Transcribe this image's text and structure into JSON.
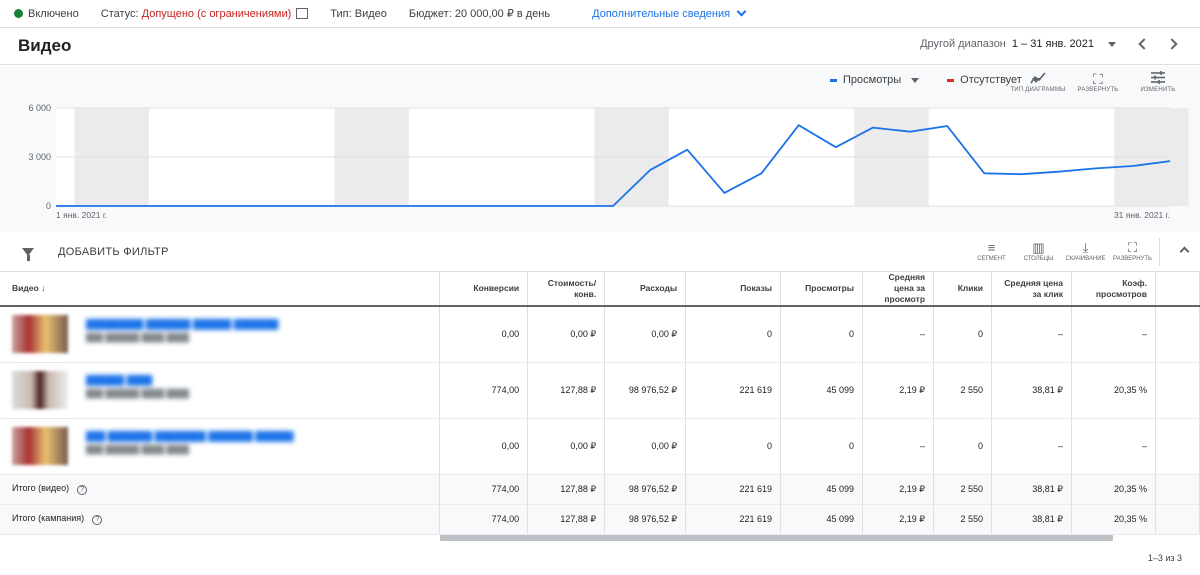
{
  "topbar": {
    "status_on": "Включено",
    "status_label": "Статус:",
    "status_value": "Допущено (с ограничениями)",
    "type_label": "Тип:",
    "type_value": "Видео",
    "budget_label": "Бюджет:",
    "budget_value": "20 000,00 ₽ в день",
    "extra": "Дополнительные сведения",
    "status_on_color": "#188038",
    "status_value_color": "#c5221f"
  },
  "header": {
    "title": "Видео",
    "range_label": "Другой диапазон",
    "range_value": "1 – 31 янв. 2021"
  },
  "chart_toolbar": {
    "legend1": "Просмотры",
    "legend1_color": "#1a73e8",
    "legend2": "Отсутствует",
    "legend2_color": "#d93025",
    "type": "ТИП ДИАГРАММЫ",
    "expand": "РАЗВЕРНУТЬ",
    "edit": "ИЗМЕНИТЬ"
  },
  "chart_data": {
    "type": "line",
    "x_start_label": "1 янв. 2021 г.",
    "x_end_label": "31 янв. 2021 г.",
    "y_ticks": [
      "6 000",
      "3 000",
      "0"
    ],
    "ylim": [
      0,
      6000
    ],
    "grid": true,
    "weekend_shading": true,
    "series": [
      {
        "name": "Просмотры",
        "color": "#1a73e8",
        "x": [
          "1 янв.",
          "2 янв.",
          "3 янв.",
          "4 янв.",
          "5 янв.",
          "6 янв.",
          "7 янв.",
          "8 янв.",
          "9 янв.",
          "10 янв.",
          "11 янв.",
          "12 янв.",
          "13 янв.",
          "14 янв.",
          "15 янв.",
          "16 янв.",
          "17 янв.",
          "18 янв.",
          "19 янв.",
          "20 янв.",
          "21 янв.",
          "22 янв.",
          "23 янв.",
          "24 янв.",
          "25 янв.",
          "26 янв.",
          "27 янв.",
          "28 янв.",
          "29 янв.",
          "30 янв.",
          "31 янв."
        ],
        "values": [
          0,
          0,
          0,
          0,
          0,
          0,
          0,
          0,
          0,
          0,
          0,
          0,
          0,
          0,
          0,
          0,
          2200,
          3450,
          800,
          2000,
          4950,
          3600,
          4800,
          4550,
          4900,
          2000,
          1950,
          2100,
          2300,
          2450,
          2750
        ]
      }
    ]
  },
  "filterbar": {
    "add_filter": "ДОБАВИТЬ ФИЛЬТР",
    "segment": "СЕГМЕНТ",
    "columns": "СТОЛБЦЫ",
    "download": "СКАЧИВАНИЕ",
    "expand": "РАЗВЕРНУТЬ"
  },
  "table": {
    "headers": [
      "Видео",
      "Конверсии",
      "Стоимость/ конв.",
      "Расходы",
      "Показы",
      "Просмотры",
      "Средняя цена за просмотр",
      "Клики",
      "Средняя цена за клик",
      "Коэф. просмотров"
    ],
    "rows": [
      [
        "0,00",
        "0,00 ₽",
        "0,00 ₽",
        "0",
        "0",
        "–",
        "0",
        "–",
        "–"
      ],
      [
        "774,00",
        "127,88 ₽",
        "98 976,52 ₽",
        "221 619",
        "45 099",
        "2,19 ₽",
        "2 550",
        "38,81 ₽",
        "20,35 %"
      ],
      [
        "0,00",
        "0,00 ₽",
        "0,00 ₽",
        "0",
        "0",
        "–",
        "0",
        "–",
        "–"
      ]
    ],
    "totals": [
      {
        "label": "Итого (видео)",
        "values": [
          "774,00",
          "127,88 ₽",
          "98 976,52 ₽",
          "221 619",
          "45 099",
          "2,19 ₽",
          "2 550",
          "38,81 ₽",
          "20,35 %"
        ]
      },
      {
        "label": "Итого (кампания)",
        "values": [
          "774,00",
          "127,88 ₽",
          "98 976,52 ₽",
          "221 619",
          "45 099",
          "2,19 ₽",
          "2 550",
          "38,81 ₽",
          "20,35 %"
        ]
      }
    ]
  },
  "pager": "1–3 из 3"
}
